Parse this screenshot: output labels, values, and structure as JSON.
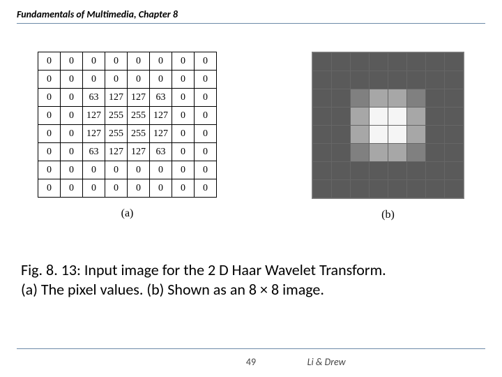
{
  "header": {
    "title": "Fundamentals of Multimedia, Chapter 8"
  },
  "figure": {
    "label_a": "(a)",
    "label_b": "(b)",
    "matrix": [
      [
        0,
        0,
        0,
        0,
        0,
        0,
        0,
        0
      ],
      [
        0,
        0,
        0,
        0,
        0,
        0,
        0,
        0
      ],
      [
        0,
        0,
        63,
        127,
        127,
        63,
        0,
        0
      ],
      [
        0,
        0,
        127,
        255,
        255,
        127,
        0,
        0
      ],
      [
        0,
        0,
        127,
        255,
        255,
        127,
        0,
        0
      ],
      [
        0,
        0,
        63,
        127,
        127,
        63,
        0,
        0
      ],
      [
        0,
        0,
        0,
        0,
        0,
        0,
        0,
        0
      ],
      [
        0,
        0,
        0,
        0,
        0,
        0,
        0,
        0
      ]
    ]
  },
  "caption": {
    "line1": "Fig. 8. 13: Input image for the 2 D Haar Wavelet Transform.",
    "line2": "(a) The pixel values. (b) Shown as an 8 × 8 image."
  },
  "footer": {
    "page": "49",
    "authors": "Li & Drew"
  },
  "chart_data": {
    "type": "table",
    "title": "8×8 pixel intensity matrix for 2D Haar Wavelet Transform input",
    "rows": 8,
    "cols": 8,
    "value_range": [
      0,
      255
    ],
    "values": [
      [
        0,
        0,
        0,
        0,
        0,
        0,
        0,
        0
      ],
      [
        0,
        0,
        0,
        0,
        0,
        0,
        0,
        0
      ],
      [
        0,
        0,
        63,
        127,
        127,
        63,
        0,
        0
      ],
      [
        0,
        0,
        127,
        255,
        255,
        127,
        0,
        0
      ],
      [
        0,
        0,
        127,
        255,
        255,
        127,
        0,
        0
      ],
      [
        0,
        0,
        63,
        127,
        127,
        63,
        0,
        0
      ],
      [
        0,
        0,
        0,
        0,
        0,
        0,
        0,
        0
      ],
      [
        0,
        0,
        0,
        0,
        0,
        0,
        0,
        0
      ]
    ],
    "note": "In (b) 0 renders dark gray, 255 renders white (inverted display)."
  }
}
